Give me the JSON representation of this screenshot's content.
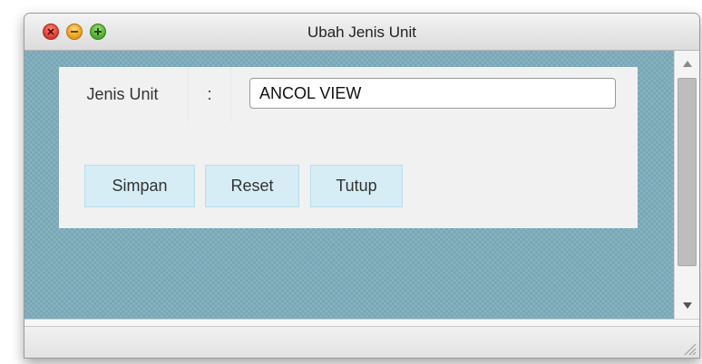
{
  "window": {
    "title": "Ubah Jenis Unit"
  },
  "form": {
    "label": "Jenis Unit",
    "separator": ":",
    "input_value": "ANCOL VIEW"
  },
  "buttons": {
    "simpan": "Simpan",
    "reset": "Reset",
    "tutup": "Tutup"
  },
  "icons": {
    "close": "close-icon",
    "minimize": "minimize-icon",
    "maximize": "maximize-icon",
    "resize": "resize-grip-icon"
  },
  "colors": {
    "background": "#7eaebd",
    "panel": "#f1f1f1",
    "button": "#d6edf6"
  }
}
